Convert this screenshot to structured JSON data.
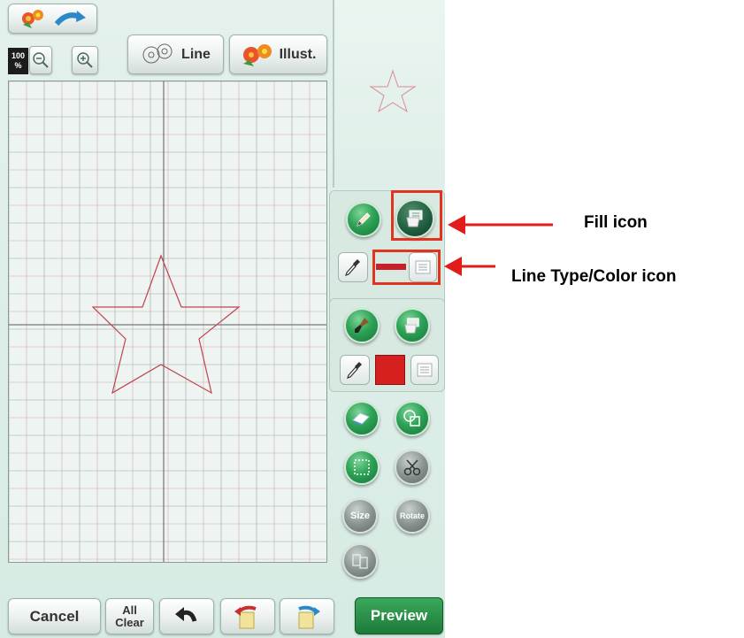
{
  "toolbar": {
    "zoom_level_line1": "100",
    "zoom_level_line2": "%",
    "line_label": "Line",
    "illust_label": "Illust."
  },
  "bottom_bar": {
    "cancel_label": "Cancel",
    "all_clear_line1": "All",
    "all_clear_line2": "Clear",
    "preview_label": "Preview"
  },
  "tools": {
    "size_label": "Size",
    "rotate_label": "Rotate",
    "line_color": "#c8202a",
    "fill_color": "#d61f1f"
  },
  "callouts": {
    "fill_icon": "Fill icon",
    "line_type_color_icon": "Line Type/Color icon"
  },
  "colors": {
    "grid_minor": "#d9a6b4",
    "grid_major": "#5a5a5a",
    "star_stroke": "#c0434f",
    "highlight": "#e0341f",
    "arrow": "#e21b1b"
  }
}
